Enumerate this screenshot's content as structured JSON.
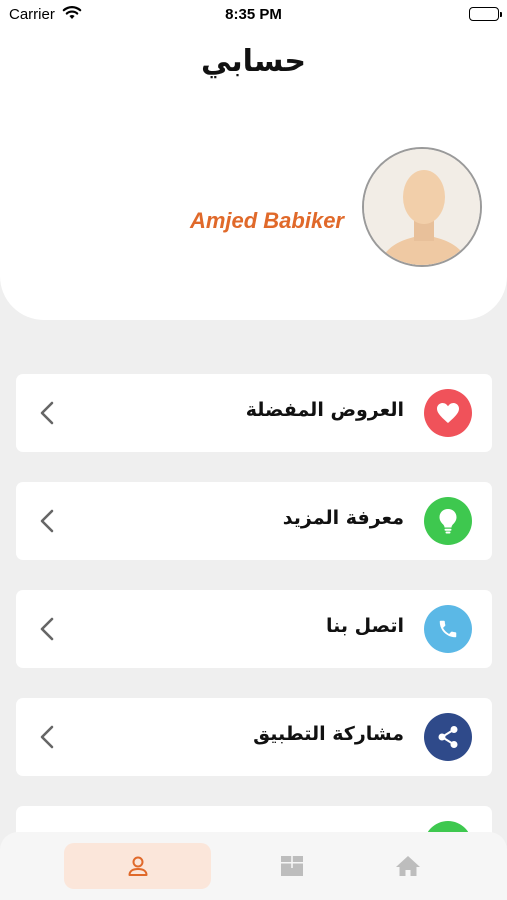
{
  "status_bar": {
    "carrier": "Carrier",
    "time": "8:35 PM"
  },
  "header": {
    "title": "حسابي"
  },
  "profile": {
    "name": "Amjed Babiker"
  },
  "menu": {
    "items": [
      {
        "label": "العروض المفضلة",
        "icon": "heart-icon",
        "color": "#f0525a"
      },
      {
        "label": "معرفة المزيد",
        "icon": "lightbulb-icon",
        "color": "#3ec84f"
      },
      {
        "label": "اتصل بنا",
        "icon": "phone-icon",
        "color": "#5bb8e6"
      },
      {
        "label": "مشاركة التطبيق",
        "icon": "share-icon",
        "color": "#2f4a8a"
      },
      {
        "label": "",
        "icon": "partial-icon",
        "color": "#3ec84f"
      }
    ]
  },
  "bottom_nav": {
    "tabs": [
      {
        "id": "account",
        "icon": "user-icon",
        "active": true
      },
      {
        "id": "packages",
        "icon": "box-icon",
        "active": false
      },
      {
        "id": "home",
        "icon": "home-icon",
        "active": false
      }
    ],
    "accent": "#e0692a",
    "active_bg": "#fbe6da"
  }
}
